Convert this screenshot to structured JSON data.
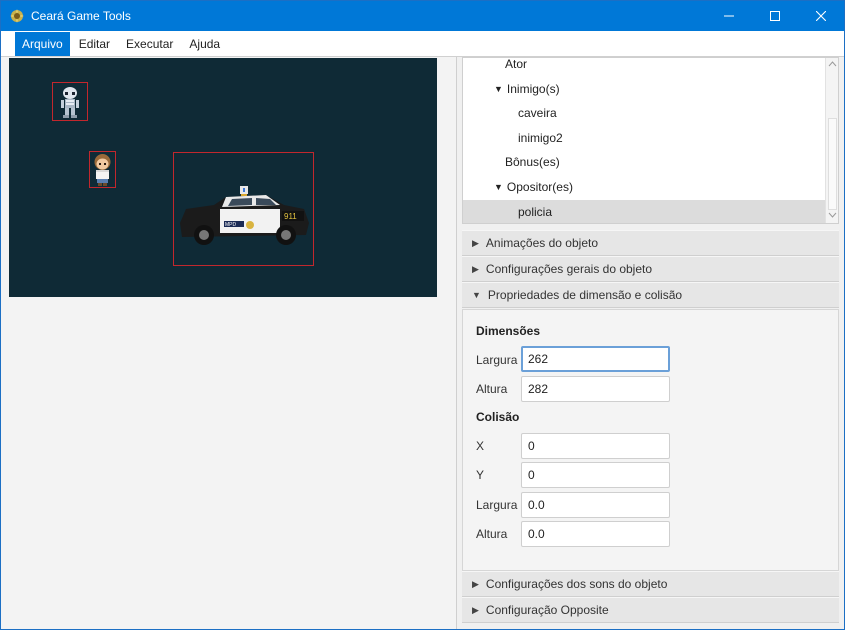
{
  "window": {
    "title": "Ceará Game Tools",
    "controls": {
      "minimize": "—",
      "maximize": "☐",
      "close": "✕"
    }
  },
  "menu": {
    "items": [
      {
        "label": "Arquivo",
        "active": true
      },
      {
        "label": "Editar",
        "active": false
      },
      {
        "label": "Executar",
        "active": false
      },
      {
        "label": "Ajuda",
        "active": false
      }
    ]
  },
  "stage": {
    "background": "#0f2a36",
    "sprites": [
      "skeleton",
      "girl",
      "police car"
    ]
  },
  "tree": {
    "items": [
      {
        "label": "Ator",
        "expanded": null,
        "selected": false
      },
      {
        "label": "Inimigo(s)",
        "expanded": true,
        "selected": false
      },
      {
        "label": "caveira",
        "expanded": null,
        "selected": false
      },
      {
        "label": "inimigo2",
        "expanded": null,
        "selected": false
      },
      {
        "label": "Bônus(es)",
        "expanded": null,
        "selected": false
      },
      {
        "label": "Opositor(es)",
        "expanded": true,
        "selected": false
      },
      {
        "label": "policia",
        "expanded": null,
        "selected": true
      }
    ]
  },
  "accordion": {
    "animations": "Animações do objeto",
    "general": "Configurações gerais do objeto",
    "dimension": "Propriedades de dimensão e colisão",
    "sounds": "Configurações dos sons do objeto",
    "opposite": "Configuração Opposite"
  },
  "props": {
    "dimensions_title": "Dimensões",
    "width_label": "Largura",
    "width_value": "262",
    "height_label": "Altura",
    "height_value": "282",
    "collision_title": "Colisão",
    "x_label": "X",
    "x_value": "0",
    "y_label": "Y",
    "y_value": "0",
    "col_width_label": "Largura",
    "col_width_value": "0.0",
    "col_height_label": "Altura",
    "col_height_value": "0.0"
  },
  "colors": {
    "titlebar": "#0078d7",
    "stage": "#0f2a36",
    "selection_box": "#c2272d"
  }
}
